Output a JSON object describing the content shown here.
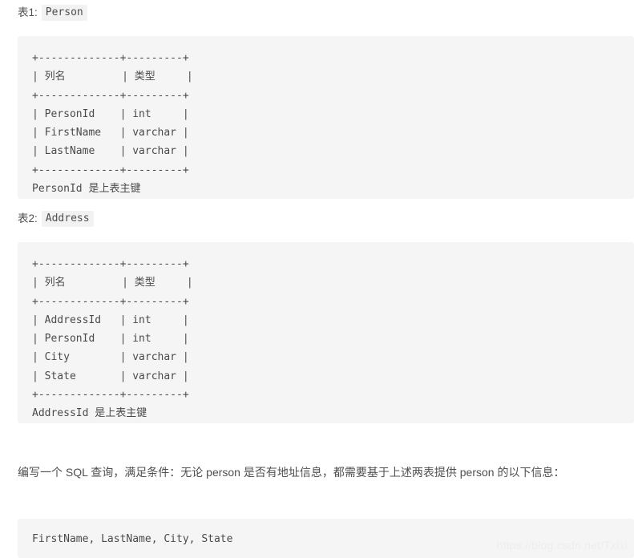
{
  "document": {
    "watermark": "https://blog.csdn.net/Txixi"
  },
  "sections": [
    {
      "caption_label": "表1:",
      "caption_code": "Person",
      "code": "+-------------+---------+\n| 列名         | 类型     |\n+-------------+---------+\n| PersonId    | int     |\n| FirstName   | varchar |\n| LastName    | varchar |\n+-------------+---------+\nPersonId 是上表主键"
    },
    {
      "caption_label": "表2:",
      "caption_code": "Address",
      "code": "+-------------+---------+\n| 列名         | 类型     |\n+-------------+---------+\n| AddressId   | int     |\n| PersonId    | int     |\n| City        | varchar |\n| State       | varchar |\n+-------------+---------+\nAddressId 是上表主键"
    }
  ],
  "prompt": {
    "text": "编写一个 SQL 查询，满足条件：无论 person 是否有地址信息，都需要基于上述两表提供 person 的以下信息："
  },
  "output_block": {
    "code": "FirstName, LastName, City, State"
  },
  "tables": [
    {
      "name": "Person",
      "headers": [
        "列名",
        "类型"
      ],
      "rows": [
        [
          "PersonId",
          "int"
        ],
        [
          "FirstName",
          "varchar"
        ],
        [
          "LastName",
          "varchar"
        ]
      ],
      "primary_key_note": "PersonId 是上表主键"
    },
    {
      "name": "Address",
      "headers": [
        "列名",
        "类型"
      ],
      "rows": [
        [
          "AddressId",
          "int"
        ],
        [
          "PersonId",
          "int"
        ],
        [
          "City",
          "varchar"
        ],
        [
          "State",
          "varchar"
        ]
      ],
      "primary_key_note": "AddressId 是上表主键"
    }
  ]
}
